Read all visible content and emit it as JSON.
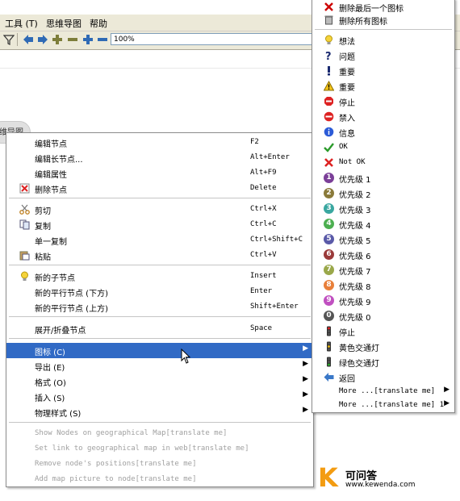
{
  "menubar": {
    "tools": "工具 (T)",
    "mindmap": "思维导图",
    "help": "帮助"
  },
  "toolbar": {
    "zoom": "100%"
  },
  "mind_node": {
    "label": "维导图"
  },
  "context_menu": {
    "items": [
      {
        "label": "编辑节点",
        "shortcut": "F2"
      },
      {
        "label": "编辑长节点...",
        "shortcut": "Alt+Enter"
      },
      {
        "label": "编辑属性",
        "shortcut": "Alt+F9"
      },
      {
        "label": "删除节点",
        "shortcut": "Delete",
        "icon": "delete-icon"
      },
      {
        "label": "剪切",
        "shortcut": "Ctrl+X",
        "icon": "scissors-icon"
      },
      {
        "label": "复制",
        "shortcut": "Ctrl+C",
        "icon": "copy-icon"
      },
      {
        "label": "单一复制",
        "shortcut": "Ctrl+Shift+C"
      },
      {
        "label": "粘贴",
        "shortcut": "Ctrl+V",
        "icon": "paste-icon"
      },
      {
        "label": "新的子节点",
        "shortcut": "Insert",
        "icon": "lightbulb-icon"
      },
      {
        "label": "新的平行节点 (下方)",
        "shortcut": "Enter"
      },
      {
        "label": "新的平行节点 (上方)",
        "shortcut": "Shift+Enter"
      },
      {
        "label": "展开/折叠节点",
        "shortcut": "Space"
      },
      {
        "label": "图标 (C)",
        "submenu": true,
        "highlighted": true
      },
      {
        "label": "导出 (E)",
        "submenu": true
      },
      {
        "label": "格式 (O)",
        "submenu": true
      },
      {
        "label": "插入 (S)",
        "submenu": true
      },
      {
        "label": "物理样式 (S)",
        "submenu": true
      },
      {
        "label": "Show Nodes on geographical Map[translate me]",
        "disabled": true
      },
      {
        "label": "Set link to geographical map in web[translate me]",
        "disabled": true
      },
      {
        "label": "Remove node's positions[translate me]",
        "disabled": true
      },
      {
        "label": "Add map picture to node[translate me]",
        "disabled": true
      }
    ]
  },
  "icon_submenu": {
    "items": [
      {
        "label": "删除最后一个图标",
        "icon": "remove-last-icon"
      },
      {
        "label": "删除所有图标",
        "icon": "trash-icon"
      },
      {
        "label": "想法",
        "icon": "idea-icon"
      },
      {
        "label": "问题",
        "icon": "question-icon"
      },
      {
        "label": "重要",
        "icon": "exclamation-icon"
      },
      {
        "label": "重要",
        "icon": "warning-icon"
      },
      {
        "label": "停止",
        "icon": "stop-sign-icon"
      },
      {
        "label": "禁入",
        "icon": "no-entry-icon"
      },
      {
        "label": "信息",
        "icon": "info-icon"
      },
      {
        "label": "OK",
        "icon": "checkmark-icon"
      },
      {
        "label": "Not OK",
        "icon": "cross-icon"
      },
      {
        "label": "优先级 1",
        "icon": "priority-1-icon"
      },
      {
        "label": "优先级 2",
        "icon": "priority-2-icon"
      },
      {
        "label": "优先级 3",
        "icon": "priority-3-icon"
      },
      {
        "label": "优先级 4",
        "icon": "priority-4-icon"
      },
      {
        "label": "优先级 5",
        "icon": "priority-5-icon"
      },
      {
        "label": "优先级 6",
        "icon": "priority-6-icon"
      },
      {
        "label": "优先级 7",
        "icon": "priority-7-icon"
      },
      {
        "label": "优先级 8",
        "icon": "priority-8-icon"
      },
      {
        "label": "优先级 9",
        "icon": "priority-9-icon"
      },
      {
        "label": "优先级 0",
        "icon": "priority-0-icon"
      },
      {
        "label": "停止",
        "icon": "traffic-light-red-icon"
      },
      {
        "label": "黄色交通灯",
        "icon": "traffic-light-yellow-icon"
      },
      {
        "label": "绿色交通灯",
        "icon": "traffic-light-green-icon"
      },
      {
        "label": "返回",
        "icon": "back-arrow-icon"
      },
      {
        "label": "More ...[translate me]",
        "submenu": true
      },
      {
        "label": "More ...[translate me] 1",
        "submenu": true
      }
    ]
  },
  "watermark": {
    "letter": "K",
    "title": "可问答",
    "url": "www.kewenda.com"
  },
  "colors": {
    "highlight": "#316ac5",
    "priority": [
      "#7b3f98",
      "#8a7a3a",
      "#3aa7a0",
      "#4caf50",
      "#5a5aa8",
      "#9a3a3a",
      "#9aa84a",
      "#e87f3a",
      "#c050c0",
      "#555555"
    ]
  }
}
